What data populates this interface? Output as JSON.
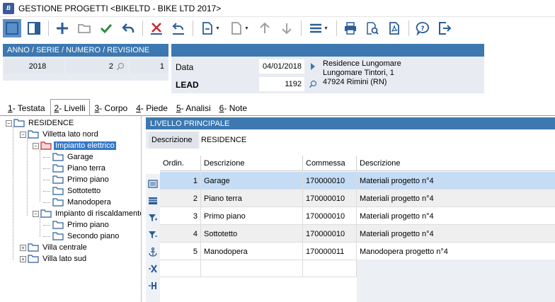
{
  "window": {
    "title": "GESTIONE PROGETTI <BIKELTD - BIKE LTD 2017>"
  },
  "toolbar": {
    "buttons": [
      "layout-icon",
      "panel-icon",
      "add-icon",
      "open-folder-icon",
      "confirm-check-icon",
      "undo-icon",
      "delete-icon",
      "revert-icon",
      "new-document-icon",
      "document-icon",
      "move-up-icon",
      "move-down-icon",
      "menu-icon",
      "print-icon",
      "print-preview-icon",
      "pdf-icon",
      "help-icon",
      "exit-icon"
    ]
  },
  "header": {
    "id_label": "ANNO / SERIE / NUMERO / REVISIONE",
    "anno": "2018",
    "numero": "2",
    "revisione": "1",
    "data_label": "Data",
    "data_value": "04/01/2018",
    "lead_label": "LEAD",
    "lead_value": "1192",
    "customer": {
      "name": "Residence Lungomare",
      "address": "Lungomare Tintori, 1",
      "city": "47924 Rimini (RN)"
    }
  },
  "tabs": [
    {
      "key": "1",
      "label": " - Testata"
    },
    {
      "key": "2",
      "label": " - Livelli"
    },
    {
      "key": "3",
      "label": " - Corpo"
    },
    {
      "key": "4",
      "label": " - Piede"
    },
    {
      "key": "5",
      "label": " - Analisi"
    },
    {
      "key": "6",
      "label": " - Note"
    }
  ],
  "tree": {
    "root": "RESIDENCE",
    "n1": "Villetta lato nord",
    "n1a": "Impianto elettrico",
    "n1a1": "Garage",
    "n1a2": "Piano terra",
    "n1a3": "Primo piano",
    "n1a4": "Sottotetto",
    "n1a5": "Manodopera",
    "n1b": "Impianto di riscaldamento",
    "n1b1": "Primo piano",
    "n1b2": "Secondo piano",
    "n2": "Villa centrale",
    "n3": "Villa lato sud"
  },
  "level": {
    "header": "LIVELLO PRINCIPALE",
    "desc_label": "Descrizione",
    "desc_value": "RESIDENCE"
  },
  "grid": {
    "columns": [
      "Ordin.",
      "Descrizione",
      "Commessa",
      "Descrizione"
    ],
    "rows": [
      {
        "ord": "1",
        "desc": "Garage",
        "commessa": "170000010",
        "desc2": "Materiali progetto n°4"
      },
      {
        "ord": "2",
        "desc": "Piano terra",
        "commessa": "170000010",
        "desc2": "Materiali progetto n°4"
      },
      {
        "ord": "3",
        "desc": "Primo piano",
        "commessa": "170000010",
        "desc2": "Materiali progetto n°4"
      },
      {
        "ord": "4",
        "desc": "Sottotetto",
        "commessa": "170000010",
        "desc2": "Materiali progetto n°4"
      },
      {
        "ord": "5",
        "desc": "Manodopera",
        "commessa": "170000011",
        "desc2": "Manodopera progetto n°4"
      }
    ]
  },
  "colors": {
    "accent": "#3d78b0",
    "selected_row": "#c5dcf5",
    "tree_selected": "#3478c8"
  }
}
